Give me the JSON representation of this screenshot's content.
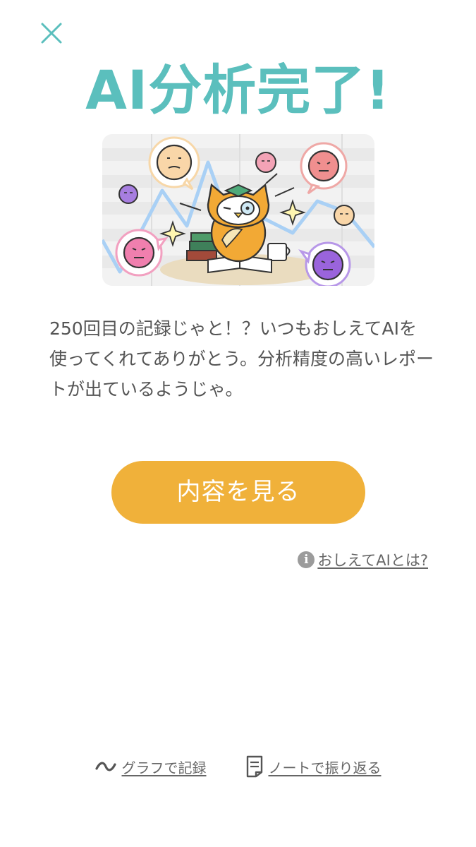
{
  "header": {
    "close_icon": "close-icon",
    "title": "AI分析完了!"
  },
  "illustration": {
    "description_icon": "owl-analyzing-illustration"
  },
  "message": {
    "text": "250回目の記録じゃと！？いつもおしえてAIを使ってくれてありがとう。分析精度の高いレポートが出ているようじゃ。"
  },
  "primary_button": {
    "label": "内容を見る"
  },
  "about": {
    "info_icon": "info-icon",
    "label": "おしえてAIとは?"
  },
  "footer": {
    "graph": {
      "icon": "wave-icon",
      "label": "グラフで記録"
    },
    "note": {
      "icon": "note-icon",
      "label": "ノートで振り返る"
    }
  },
  "colors": {
    "title": "#5bbfbd",
    "close": "#5bbfbd",
    "button": "#f0b13a",
    "text": "#555555",
    "link": "#666666"
  }
}
